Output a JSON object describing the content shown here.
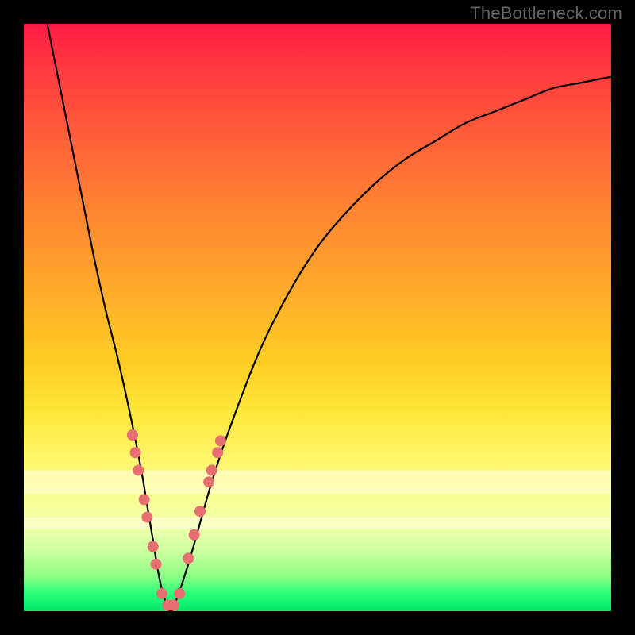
{
  "watermark": "TheBottleneck.com",
  "chart_data": {
    "type": "line",
    "title": "",
    "xlabel": "",
    "ylabel": "",
    "xlim": [
      0,
      100
    ],
    "ylim": [
      0,
      100
    ],
    "grid": false,
    "legend": false,
    "background_gradient": {
      "top": "#ff1a44",
      "mid": "#ffe63a",
      "bottom": "#00e66a"
    },
    "pale_bands_y": [
      {
        "from": 20,
        "to": 24
      },
      {
        "from": 14,
        "to": 16
      }
    ],
    "series": [
      {
        "name": "bottleneck-curve",
        "color": "#000000",
        "x": [
          4,
          6,
          8,
          10,
          12,
          14,
          16,
          18,
          20,
          21,
          22,
          23,
          24,
          25,
          26,
          28,
          30,
          32,
          35,
          40,
          45,
          50,
          55,
          60,
          65,
          70,
          75,
          80,
          85,
          90,
          95,
          100
        ],
        "y": [
          100,
          90,
          80,
          70,
          60,
          51,
          43,
          34,
          24,
          18,
          12,
          6,
          2,
          0,
          2,
          8,
          15,
          22,
          31,
          44,
          54,
          62,
          68,
          73,
          77,
          80,
          83,
          85,
          87,
          89,
          90,
          91
        ]
      }
    ],
    "markers": {
      "name": "highlight-dots",
      "color": "#e76f6f",
      "radius_px": 7,
      "points": [
        {
          "x": 18.5,
          "y": 30
        },
        {
          "x": 19.0,
          "y": 27
        },
        {
          "x": 19.5,
          "y": 24
        },
        {
          "x": 20.5,
          "y": 19
        },
        {
          "x": 21.0,
          "y": 16
        },
        {
          "x": 22.0,
          "y": 11
        },
        {
          "x": 22.5,
          "y": 8
        },
        {
          "x": 23.5,
          "y": 3
        },
        {
          "x": 24.5,
          "y": 1
        },
        {
          "x": 25.5,
          "y": 1
        },
        {
          "x": 26.5,
          "y": 3
        },
        {
          "x": 28.0,
          "y": 9
        },
        {
          "x": 29.0,
          "y": 13
        },
        {
          "x": 30.0,
          "y": 17
        },
        {
          "x": 31.5,
          "y": 22
        },
        {
          "x": 32.0,
          "y": 24
        },
        {
          "x": 33.0,
          "y": 27
        },
        {
          "x": 33.5,
          "y": 29
        }
      ]
    }
  }
}
